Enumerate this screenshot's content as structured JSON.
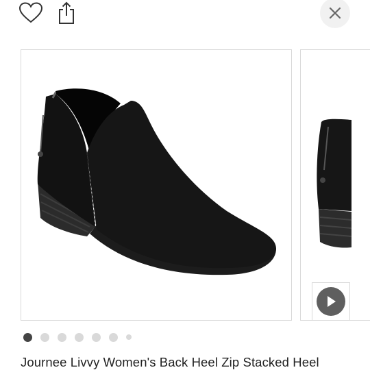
{
  "header": {
    "favorite_icon": "heart-outline-icon",
    "share_icon": "share-icon",
    "close_icon": "close-x-icon"
  },
  "gallery": {
    "main_image": "black suede ankle bootie with back zipper and stacked heel",
    "next_image": "back view of black bootie with zipper and stacked heel",
    "video_icon": "play-icon",
    "dots_total": 7,
    "active_dot": 1
  },
  "product": {
    "title": "Journee Livvy Women's Back Heel Zip Stacked Heel"
  },
  "colors": {
    "active_dot": "#444444",
    "inactive_dot": "#d9d9d9",
    "play_button": "#5f5f5f",
    "close_bg": "#f1f1f1",
    "border": "#d8d8d8"
  }
}
